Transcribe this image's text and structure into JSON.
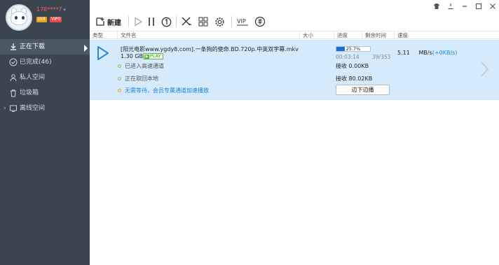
{
  "window": {
    "controls": [
      "skin-icon",
      "minimize-icon",
      "menu-icon",
      "maximize-icon",
      "close-icon"
    ]
  },
  "user": {
    "name": "178****7",
    "level": "LV4",
    "vip": "VIP0"
  },
  "sidebar": {
    "items": [
      {
        "label": "正在下载",
        "icon": "download-icon",
        "active": true
      },
      {
        "label": "已完成(46)",
        "icon": "check-circle-icon",
        "active": false
      },
      {
        "label": "私人空间",
        "icon": "user-icon",
        "active": false
      },
      {
        "label": "垃圾箱",
        "icon": "trash-icon",
        "active": false
      },
      {
        "label": "离线空间",
        "icon": "offline-icon",
        "active": false
      }
    ]
  },
  "toolbar": {
    "new_label": "新建",
    "icons": [
      "new-task-icon",
      "start-icon",
      "pause-icon",
      "limit-speed-icon",
      "delete-icon",
      "grid-icon",
      "settings-icon",
      "vip-icon",
      "gift-icon"
    ]
  },
  "table": {
    "columns": [
      "类型",
      "文件名",
      "大小",
      "进度",
      "剩余时间",
      "速度"
    ]
  },
  "task": {
    "filename": "[阳光电影www.ygdy8.com].一条狗的使命.BD.720p.中英双字幕.mkv",
    "size": "1.30 GB",
    "play_badge": "PLAY",
    "progress_pct": 25.7,
    "progress_label": "25.7%",
    "elapsed": "00:03:14",
    "pieces": "39/353",
    "speed_value": "5.11",
    "speed_unit": "MB/s",
    "speed_bonus": "(+0KB/s)",
    "channels": [
      {
        "text": "已进入高速通道",
        "receive": "接收 0.00KB"
      },
      {
        "text": "正在取回本地",
        "receive": "接收 80.02KB"
      },
      {
        "text": "无需等待，会员专属通道加速播放"
      }
    ],
    "stream_button": "边下边播"
  },
  "colors": {
    "sidebar": "#3a4550",
    "accent": "#1f84d8",
    "selection": "#d5ebfb",
    "progress": "#1d6fd2"
  }
}
